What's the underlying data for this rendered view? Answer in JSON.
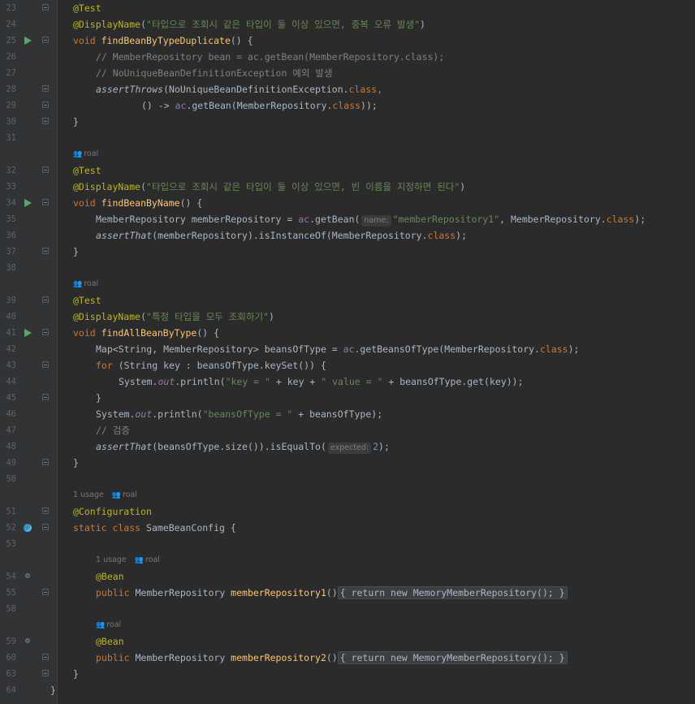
{
  "editor": {
    "lines": [
      {
        "n": "23",
        "parts": [
          [
            "ann",
            "@Test"
          ]
        ],
        "indent": 1
      },
      {
        "n": "24",
        "parts": [
          [
            "ann",
            "@DisplayName"
          ],
          [
            "p",
            "("
          ],
          [
            "str",
            "\"타입으로 조회시 같은 타입이 둘 이상 있으면, 중복 오류 발생\""
          ],
          [
            "p",
            ")"
          ]
        ],
        "indent": 1
      },
      {
        "n": "25",
        "parts": [
          [
            "kw",
            "void "
          ],
          [
            "fn",
            "findBeanByTypeDuplicate"
          ],
          [
            "p",
            "() {"
          ]
        ],
        "indent": 1,
        "icon": "run"
      },
      {
        "n": "26",
        "parts": [
          [
            "cmt",
            "// MemberRepository bean = ac.getBean(MemberRepository.class);"
          ]
        ],
        "indent": 2
      },
      {
        "n": "27",
        "parts": [
          [
            "cmt",
            "// NoUniqueBeanDefinitionException 예외 발생"
          ]
        ],
        "indent": 2
      },
      {
        "n": "28",
        "parts": [
          [
            "it",
            "assertThrows"
          ],
          [
            "p",
            "(NoUniqueBeanDefinitionException."
          ],
          [
            "kw",
            "class"
          ],
          [
            "kw",
            ","
          ]
        ],
        "indent": 2
      },
      {
        "n": "29",
        "parts": [
          [
            "p",
            "() -> "
          ],
          [
            "field2",
            "ac"
          ],
          [
            "p",
            ".getBean(MemberRepository."
          ],
          [
            "kw",
            "class"
          ],
          [
            "p",
            "));"
          ]
        ],
        "indent": 4
      },
      {
        "n": "30",
        "parts": [
          [
            "p",
            "}"
          ]
        ],
        "indent": 1
      },
      {
        "n": "31",
        "parts": [],
        "indent": 0
      },
      {
        "meta": [
          "",
          "roal"
        ]
      },
      {
        "n": "32",
        "parts": [
          [
            "ann",
            "@Test"
          ]
        ],
        "indent": 1
      },
      {
        "n": "33",
        "parts": [
          [
            "ann",
            "@DisplayName"
          ],
          [
            "p",
            "("
          ],
          [
            "str",
            "\"타입으로 조회시 같은 타입이 둘 이상 있으면, 빈 이름을 지정하면 된다\""
          ],
          [
            "p",
            ")"
          ]
        ],
        "indent": 1
      },
      {
        "n": "34",
        "parts": [
          [
            "kw",
            "void "
          ],
          [
            "fn",
            "findBeanByName"
          ],
          [
            "p",
            "() {"
          ]
        ],
        "indent": 1,
        "icon": "run"
      },
      {
        "n": "35",
        "parts": [
          [
            "p",
            "MemberRepository memberRepository = "
          ],
          [
            "field2",
            "ac"
          ],
          [
            "p",
            ".getBean("
          ],
          [
            "hint",
            "name:"
          ],
          [
            "str",
            "\"memberRepository1\""
          ],
          [
            "p",
            ", MemberRepository."
          ],
          [
            "kw",
            "class"
          ],
          [
            "p",
            ");"
          ]
        ],
        "indent": 2
      },
      {
        "n": "36",
        "parts": [
          [
            "it",
            "assertThat"
          ],
          [
            "p",
            "(memberRepository).isInstanceOf(MemberRepository."
          ],
          [
            "kw",
            "class"
          ],
          [
            "p",
            ");"
          ]
        ],
        "indent": 2
      },
      {
        "n": "37",
        "parts": [
          [
            "p",
            "}"
          ]
        ],
        "indent": 1
      },
      {
        "n": "38",
        "parts": [],
        "indent": 0
      },
      {
        "meta": [
          "",
          "roal"
        ]
      },
      {
        "n": "39",
        "parts": [
          [
            "ann",
            "@Test"
          ]
        ],
        "indent": 1
      },
      {
        "n": "40",
        "parts": [
          [
            "ann",
            "@DisplayName"
          ],
          [
            "p",
            "("
          ],
          [
            "str",
            "\"특정 타입을 모두 조회하기\""
          ],
          [
            "p",
            ")"
          ]
        ],
        "indent": 1
      },
      {
        "n": "41",
        "parts": [
          [
            "kw",
            "void "
          ],
          [
            "fn",
            "findAllBeanByType"
          ],
          [
            "p",
            "() {"
          ]
        ],
        "indent": 1,
        "icon": "run"
      },
      {
        "n": "42",
        "parts": [
          [
            "p",
            "Map<String, MemberRepository> beansOfType = "
          ],
          [
            "field2",
            "ac"
          ],
          [
            "p",
            ".getBeansOfType(MemberRepository."
          ],
          [
            "kw",
            "class"
          ],
          [
            "p",
            ");"
          ]
        ],
        "indent": 2
      },
      {
        "n": "43",
        "parts": [
          [
            "kw",
            "for "
          ],
          [
            "p",
            "(String key : beansOfType.keySet()) {"
          ]
        ],
        "indent": 2
      },
      {
        "n": "44",
        "parts": [
          [
            "p",
            "System."
          ],
          [
            "field",
            "out"
          ],
          [
            "p",
            ".println("
          ],
          [
            "str",
            "\"key = \""
          ],
          [
            "p",
            " + key + "
          ],
          [
            "str",
            "\" value = \""
          ],
          [
            "p",
            " + beansOfType.get(key));"
          ]
        ],
        "indent": 3
      },
      {
        "n": "45",
        "parts": [
          [
            "p",
            "}"
          ]
        ],
        "indent": 2
      },
      {
        "n": "46",
        "parts": [
          [
            "p",
            "System."
          ],
          [
            "field",
            "out"
          ],
          [
            "p",
            ".println("
          ],
          [
            "str",
            "\"beansOfType = \""
          ],
          [
            "p",
            " + beansOfType);"
          ]
        ],
        "indent": 2
      },
      {
        "n": "47",
        "parts": [
          [
            "cmt",
            "// 검증"
          ]
        ],
        "indent": 2
      },
      {
        "n": "48",
        "parts": [
          [
            "it",
            "assertThat"
          ],
          [
            "p",
            "(beansOfType.size()).isEqualTo("
          ],
          [
            "hint",
            "expected:"
          ],
          [
            "num",
            "2"
          ],
          [
            "p",
            ");"
          ]
        ],
        "indent": 2
      },
      {
        "n": "49",
        "parts": [
          [
            "p",
            "}"
          ]
        ],
        "indent": 1
      },
      {
        "n": "50",
        "parts": [],
        "indent": 0
      },
      {
        "meta": [
          "1 usage",
          "roal"
        ]
      },
      {
        "n": "51",
        "parts": [
          [
            "ann",
            "@Configuration"
          ]
        ],
        "indent": 1
      },
      {
        "n": "52",
        "parts": [
          [
            "kw",
            "static class "
          ],
          [
            "p",
            "SameBeanConfig {"
          ]
        ],
        "indent": 1,
        "icon": "cfg"
      },
      {
        "n": "53",
        "parts": [],
        "indent": 0
      },
      {
        "meta": [
          "1 usage",
          "roal"
        ],
        "metaIndent": 2
      },
      {
        "n": "54",
        "parts": [
          [
            "ann",
            "@Bean"
          ]
        ],
        "indent": 2,
        "icon": "bean"
      },
      {
        "n": "55",
        "parts": [
          [
            "kw",
            "public "
          ],
          [
            "p",
            "MemberRepository "
          ],
          [
            "fn",
            "memberRepository1"
          ],
          [
            "p",
            "()"
          ],
          [
            "fold",
            "{ return new MemoryMemberRepository(); }"
          ]
        ],
        "indent": 2
      },
      {
        "n": "58",
        "parts": [],
        "indent": 0
      },
      {
        "meta": [
          "",
          "roal"
        ],
        "metaIndent": 2
      },
      {
        "n": "59",
        "parts": [
          [
            "ann",
            "@Bean"
          ]
        ],
        "indent": 2,
        "icon": "bean"
      },
      {
        "n": "60",
        "parts": [
          [
            "kw",
            "public "
          ],
          [
            "p",
            "MemberRepository "
          ],
          [
            "fn",
            "memberRepository2"
          ],
          [
            "p",
            "()"
          ],
          [
            "fold",
            "{ return new MemoryMemberRepository(); }"
          ]
        ],
        "indent": 2
      },
      {
        "n": "63",
        "parts": [
          [
            "p",
            "}"
          ]
        ],
        "indent": 1
      },
      {
        "n": "64",
        "parts": [
          [
            "p",
            "}"
          ]
        ],
        "indent": 0
      }
    ]
  }
}
